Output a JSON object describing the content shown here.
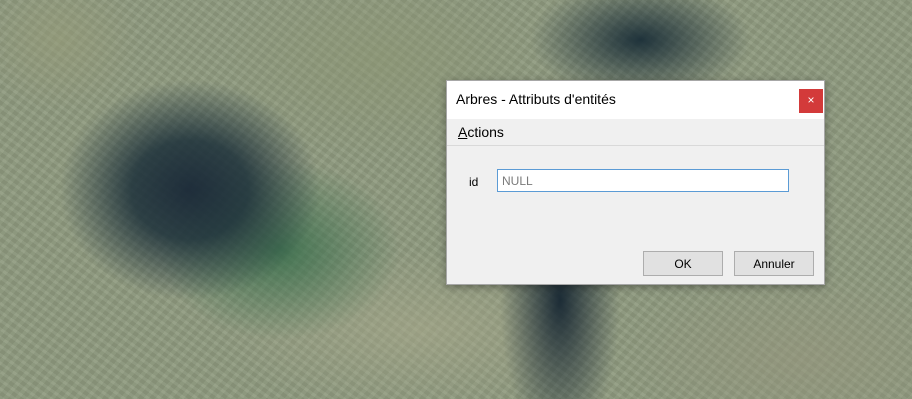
{
  "dialog": {
    "title": "Arbres - Attributs d'entités",
    "close_glyph": "×",
    "menu": {
      "actions_mnemonic": "A",
      "actions_rest": "ctions"
    },
    "fields": [
      {
        "label": "id",
        "value": "",
        "placeholder": "NULL"
      }
    ],
    "buttons": {
      "ok": "OK",
      "cancel": "Annuler"
    }
  },
  "colors": {
    "close_button": "#d33a3a",
    "input_focus_border": "#5b9bd5",
    "dialog_background": "#f0f0f0"
  },
  "icons": {
    "close": "close-icon"
  }
}
